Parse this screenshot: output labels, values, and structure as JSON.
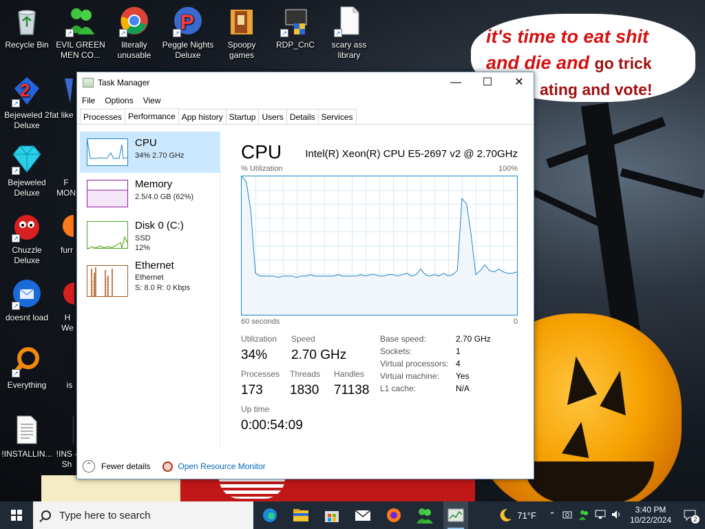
{
  "desktop": {
    "icons": [
      {
        "label": "Recycle Bin"
      },
      {
        "label": "EVIL GREEN MEN CO..."
      },
      {
        "label": "literally unusable"
      },
      {
        "label": "Peggle Nights Deluxe"
      },
      {
        "label": "Spoopy games"
      },
      {
        "label": "RDP_CnC"
      },
      {
        "label": "scary ass library"
      },
      {
        "label": "Bejeweled 2 Deluxe"
      },
      {
        "label": "fat like"
      },
      {
        "label": "Bejeweled Deluxe"
      },
      {
        "label": "F MON"
      },
      {
        "label": "Chuzzle Deluxe"
      },
      {
        "label": "furr"
      },
      {
        "label": "doesnt load"
      },
      {
        "label": "H We"
      },
      {
        "label": "Everything"
      },
      {
        "label": "is"
      },
      {
        "label": "!INSTALLIN..."
      },
      {
        "label": "!INS - Sh"
      }
    ],
    "speech_line1": "it's time to eat shit",
    "speech_line2a": "and die and",
    "speech_line2b": "go trick",
    "speech_line3": "ating and vote!"
  },
  "task_manager": {
    "title": "Task Manager",
    "menu": [
      "File",
      "Options",
      "View"
    ],
    "tabs": [
      "Processes",
      "Performance",
      "App history",
      "Startup",
      "Users",
      "Details",
      "Services"
    ],
    "active_tab": "Performance",
    "resources": [
      {
        "name": "CPU",
        "sub1": "34% 2.70 GHz",
        "sub2": ""
      },
      {
        "name": "Memory",
        "sub1": "2.5/4.0 GB (62%)",
        "sub2": ""
      },
      {
        "name": "Disk 0 (C:)",
        "sub1": "SSD",
        "sub2": "12%"
      },
      {
        "name": "Ethernet",
        "sub1": "Ethernet",
        "sub2": "S: 8.0 R: 0 Kbps"
      }
    ],
    "cpu_title": "CPU",
    "cpu_model": "Intel(R) Xeon(R) CPU E5-2697 v2 @ 2.70GHz",
    "graph": {
      "y_label": "% Utilization",
      "y_max_label": "100%",
      "x_left_label": "60 seconds",
      "x_right_label": "0"
    },
    "stats": {
      "utilization_label": "Utilization",
      "utilization": "34%",
      "speed_label": "Speed",
      "speed": "2.70 GHz",
      "processes_label": "Processes",
      "processes": "173",
      "threads_label": "Threads",
      "threads": "1830",
      "handles_label": "Handles",
      "handles": "71138",
      "uptime_label": "Up time",
      "uptime": "0:00:54:09"
    },
    "info": [
      {
        "label": "Base speed:",
        "value": "2.70 GHz"
      },
      {
        "label": "Sockets:",
        "value": "1"
      },
      {
        "label": "Virtual processors:",
        "value": "4"
      },
      {
        "label": "Virtual machine:",
        "value": "Yes"
      },
      {
        "label": "L1 cache:",
        "value": "N/A"
      }
    ],
    "footer": {
      "fewer_details": "Fewer details",
      "resource_monitor": "Open Resource Monitor"
    }
  },
  "taskbar": {
    "search_placeholder": "Type here to search",
    "weather": "71°F",
    "time": "3:40 PM",
    "date": "10/22/2024",
    "notifications": "2"
  },
  "chart_data": {
    "type": "line",
    "x_range": [
      60,
      0
    ],
    "ylim": [
      0,
      100
    ],
    "series": [
      {
        "values": [
          100,
          96,
          75,
          30,
          28,
          28,
          28,
          28,
          27,
          28,
          28,
          28,
          27,
          28,
          28,
          29,
          28,
          28,
          28,
          28,
          28,
          29,
          28,
          28,
          28,
          28,
          29,
          28,
          29,
          29,
          28,
          28,
          29,
          29,
          28,
          29,
          30,
          28,
          29,
          33,
          29,
          28,
          29,
          28,
          30,
          28,
          29,
          32,
          84,
          80,
          58,
          29,
          32,
          36,
          32,
          31,
          33,
          31,
          30,
          30,
          31
        ]
      }
    ]
  }
}
